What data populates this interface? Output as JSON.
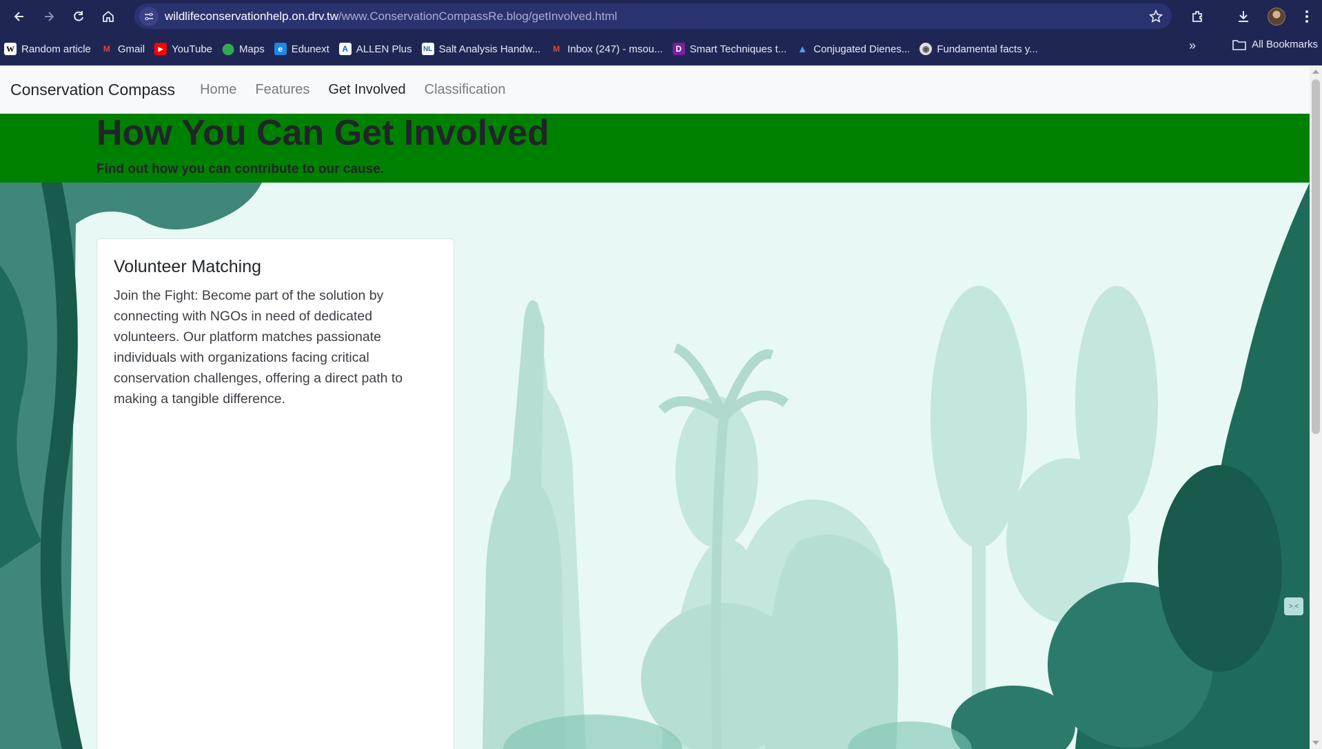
{
  "browser": {
    "url_host": "wildlifeconservationhelp.on.drv.tw",
    "url_path": "/www.ConservationCompassRe.blog/getInvolved.html",
    "bookmarks": [
      {
        "label": "Random article",
        "icon": "wikipedia-icon",
        "color": "#ffffff"
      },
      {
        "label": "Gmail",
        "icon": "gmail-icon",
        "color": "#ea4335"
      },
      {
        "label": "YouTube",
        "icon": "youtube-icon",
        "color": "#ff0000"
      },
      {
        "label": "Maps",
        "icon": "maps-icon",
        "color": "#34a853"
      },
      {
        "label": "Edunext",
        "icon": "edunext-icon",
        "color": "#1e88e5"
      },
      {
        "label": "ALLEN Plus",
        "icon": "allen-icon",
        "color": "#ffffff"
      },
      {
        "label": "Salt Analysis Handw...",
        "icon": "nl-icon",
        "color": "#1565c0"
      },
      {
        "label": "Inbox (247) - msou...",
        "icon": "gmail-icon",
        "color": "#ea4335"
      },
      {
        "label": "Smart Techniques t...",
        "icon": "doc-icon",
        "color": "#9c27b0"
      },
      {
        "label": "Conjugated Dienes...",
        "icon": "flask-icon",
        "color": "#42a5f5"
      },
      {
        "label": "Fundamental facts y...",
        "icon": "globe-icon",
        "color": "#e0e0e0"
      }
    ],
    "all_bookmarks": "All Bookmarks"
  },
  "site": {
    "brand": "Conservation Compass",
    "nav": [
      "Home",
      "Features",
      "Get Involved",
      "Classification"
    ],
    "active_nav": "Get Involved"
  },
  "hero": {
    "title": "How You Can Get Involved",
    "subtitle": "Find out how you can contribute to our cause.",
    "bg_color": "#008000"
  },
  "card": {
    "title": "Volunteer Matching",
    "text": "Join the Fight: Become part of the solution by connecting with NGOs in need of dedicated volunteers. Our platform matches passionate individuals with organizations facing critical conservation challenges, offering a direct path to making a tangible difference."
  },
  "widget": {
    "label": ">.<"
  }
}
